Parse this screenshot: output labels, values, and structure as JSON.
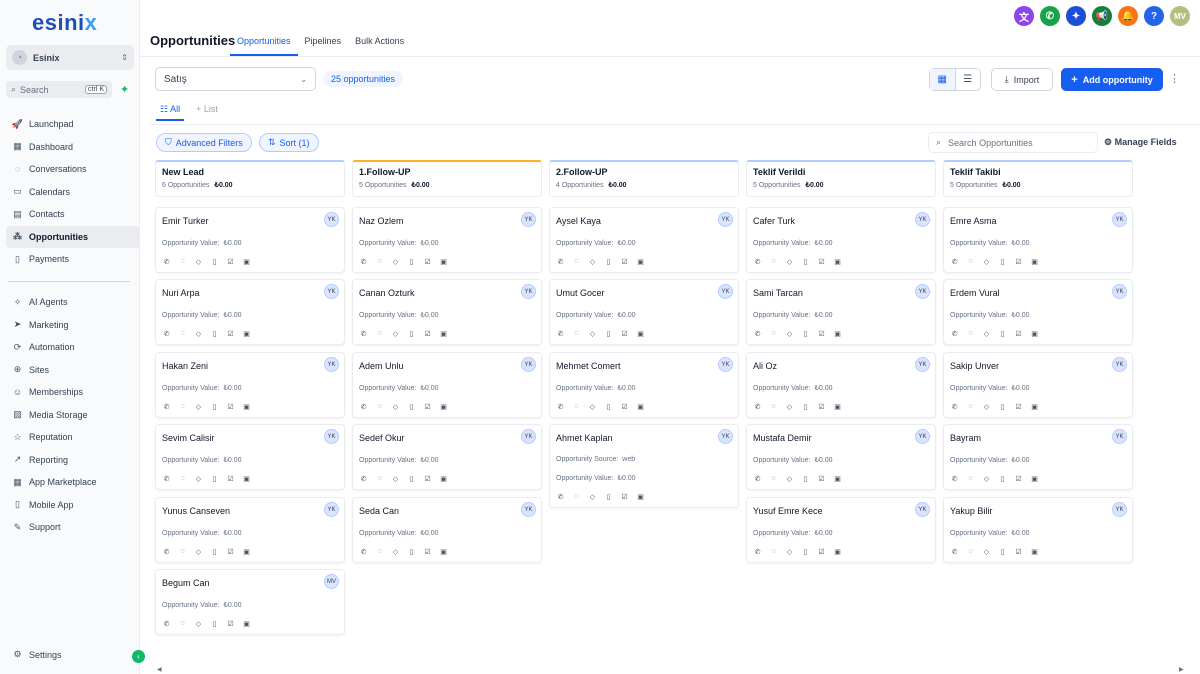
{
  "brand": {
    "logo_main": "esini",
    "logo_x": "x"
  },
  "location": {
    "name": "Esinix"
  },
  "search": {
    "label": "Search",
    "shortcut": "ctrl K"
  },
  "nav_top": [
    {
      "key": "launchpad",
      "label": "Launchpad",
      "icon": "rocket"
    },
    {
      "key": "dashboard",
      "label": "Dashboard",
      "icon": "grid"
    },
    {
      "key": "conversations",
      "label": "Conversations",
      "icon": "chat"
    },
    {
      "key": "calendars",
      "label": "Calendars",
      "icon": "calendar"
    },
    {
      "key": "contacts",
      "label": "Contacts",
      "icon": "contacts"
    },
    {
      "key": "opportunities",
      "label": "Opportunities",
      "icon": "opportunities",
      "active": true
    },
    {
      "key": "payments",
      "label": "Payments",
      "icon": "payments"
    }
  ],
  "nav_bottom": [
    {
      "key": "ai-agents",
      "label": "AI Agents",
      "icon": "sparkle"
    },
    {
      "key": "marketing",
      "label": "Marketing",
      "icon": "send"
    },
    {
      "key": "automation",
      "label": "Automation",
      "icon": "automation"
    },
    {
      "key": "sites",
      "label": "Sites",
      "icon": "globe"
    },
    {
      "key": "memberships",
      "label": "Memberships",
      "icon": "members"
    },
    {
      "key": "media-storage",
      "label": "Media Storage",
      "icon": "image"
    },
    {
      "key": "reputation",
      "label": "Reputation",
      "icon": "star"
    },
    {
      "key": "reporting",
      "label": "Reporting",
      "icon": "chart"
    },
    {
      "key": "app-marketplace",
      "label": "App Marketplace",
      "icon": "apps"
    },
    {
      "key": "mobile-app",
      "label": "Mobile App",
      "icon": "phone"
    },
    {
      "key": "support",
      "label": "Support",
      "icon": "wrench"
    }
  ],
  "settings_label": "Settings",
  "header": {
    "title": "Opportunities",
    "tabs": [
      {
        "label": "Opportunities",
        "active": true
      },
      {
        "label": "Pipelines"
      },
      {
        "label": "Bulk Actions"
      }
    ],
    "icons": [
      {
        "name": "translate-icon",
        "color": "#8e44ec",
        "glyph": "文"
      },
      {
        "name": "phone-icon",
        "color": "#16a34a",
        "glyph": "✆"
      },
      {
        "name": "magic-icon",
        "color": "#1d4ed8",
        "glyph": "✦"
      },
      {
        "name": "megaphone-icon",
        "color": "#15803d",
        "glyph": "📢"
      },
      {
        "name": "bell-icon",
        "color": "#f97316",
        "glyph": "🔔"
      },
      {
        "name": "help-icon",
        "color": "#2563eb",
        "glyph": "?"
      },
      {
        "name": "user-avatar",
        "color": "#b5bd7f",
        "glyph": "MV"
      }
    ]
  },
  "toolbar": {
    "pipeline": "Satış",
    "count": "25 opportunities",
    "import": "Import",
    "add": "Add opportunity",
    "views": [
      {
        "label": "All",
        "active": true
      },
      {
        "label": "List"
      }
    ],
    "advanced_filters": "Advanced Filters",
    "sort": "Sort (1)",
    "search_placeholder": "Search Opportunities",
    "manage_fields": "Manage Fields"
  },
  "field_label": "Opportunity Value:",
  "source_label": "Opportunity Source:",
  "columns": [
    {
      "title": "New Lead",
      "count": "6 Opportunities",
      "total": "₺0.00",
      "accent": "#b2ccff",
      "cards": [
        {
          "name": "Emir Turker",
          "value": "₺0.00",
          "avatar": "YK"
        },
        {
          "name": "Nuri Arpa",
          "value": "₺0.00",
          "avatar": "YK"
        },
        {
          "name": "Hakan Zeni",
          "value": "₺0.00",
          "avatar": "YK"
        },
        {
          "name": "Sevim Calisir",
          "value": "₺0.00",
          "avatar": "YK"
        },
        {
          "name": "Yunus Canseven",
          "value": "₺0.00",
          "avatar": "YK"
        },
        {
          "name": "Begum Can",
          "value": "₺0.00",
          "avatar": "MV"
        }
      ]
    },
    {
      "title": "1.Follow-UP",
      "count": "5 Opportunities",
      "total": "₺0.00",
      "accent": "#fdb022",
      "cards": [
        {
          "name": "Naz Ozlem",
          "value": "₺0.00",
          "avatar": "YK"
        },
        {
          "name": "Canan Ozturk",
          "value": "₺0.00",
          "avatar": "YK"
        },
        {
          "name": "Adem Unlu",
          "value": "₺0.00",
          "avatar": "YK"
        },
        {
          "name": "Sedef Okur",
          "value": "₺0.00",
          "avatar": "YK"
        },
        {
          "name": "Seda Can",
          "value": "₺0.00",
          "avatar": "YK"
        }
      ]
    },
    {
      "title": "2.Follow-UP",
      "count": "4 Opportunities",
      "total": "₺0.00",
      "accent": "#b2ccff",
      "cards": [
        {
          "name": "Aysel Kaya",
          "value": "₺0.00",
          "avatar": "YK"
        },
        {
          "name": "Umut Gocer",
          "value": "₺0.00",
          "avatar": "YK"
        },
        {
          "name": "Mehmet Comert",
          "value": "₺0.00",
          "avatar": "YK"
        },
        {
          "name": "Ahmet Kaplan",
          "value": "₺0.00",
          "avatar": "YK",
          "source": "web"
        }
      ]
    },
    {
      "title": "Teklif Verildi",
      "count": "5 Opportunities",
      "total": "₺0.00",
      "accent": "#b2ccff",
      "cards": [
        {
          "name": "Cafer Turk",
          "value": "₺0.00",
          "avatar": "YK"
        },
        {
          "name": "Sami Tarcan",
          "value": "₺0.00",
          "avatar": "YK"
        },
        {
          "name": "Ali Oz",
          "value": "₺0.00",
          "avatar": "YK"
        },
        {
          "name": "Mustafa Demir",
          "value": "₺0.00",
          "avatar": "YK"
        },
        {
          "name": "Yusuf Emre Kece",
          "value": "₺0.00",
          "avatar": "YK"
        }
      ]
    },
    {
      "title": "Teklif Takibi",
      "count": "5 Opportunities",
      "total": "₺0.00",
      "accent": "#b2ccff",
      "cards": [
        {
          "name": "Emre Asma",
          "value": "₺0.00",
          "avatar": "YK"
        },
        {
          "name": "Erdem Vural",
          "value": "₺0.00",
          "avatar": "YK"
        },
        {
          "name": "Sakip Unver",
          "value": "₺0.00",
          "avatar": "YK"
        },
        {
          "name": "Bayram",
          "value": "₺0.00",
          "avatar": "YK"
        },
        {
          "name": "Yakup Bilir",
          "value": "₺0.00",
          "avatar": "YK"
        }
      ]
    }
  ]
}
